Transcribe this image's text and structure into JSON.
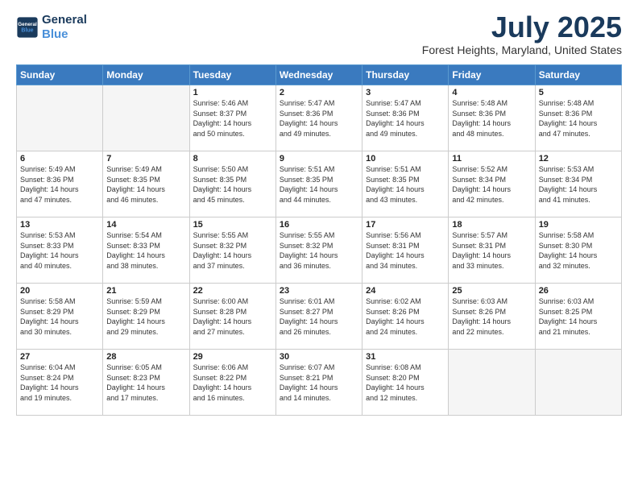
{
  "header": {
    "logo_line1": "General",
    "logo_line2": "Blue",
    "month": "July 2025",
    "location": "Forest Heights, Maryland, United States"
  },
  "days_of_week": [
    "Sunday",
    "Monday",
    "Tuesday",
    "Wednesday",
    "Thursday",
    "Friday",
    "Saturday"
  ],
  "weeks": [
    [
      {
        "day": "",
        "info": ""
      },
      {
        "day": "",
        "info": ""
      },
      {
        "day": "1",
        "info": "Sunrise: 5:46 AM\nSunset: 8:37 PM\nDaylight: 14 hours\nand 50 minutes."
      },
      {
        "day": "2",
        "info": "Sunrise: 5:47 AM\nSunset: 8:36 PM\nDaylight: 14 hours\nand 49 minutes."
      },
      {
        "day": "3",
        "info": "Sunrise: 5:47 AM\nSunset: 8:36 PM\nDaylight: 14 hours\nand 49 minutes."
      },
      {
        "day": "4",
        "info": "Sunrise: 5:48 AM\nSunset: 8:36 PM\nDaylight: 14 hours\nand 48 minutes."
      },
      {
        "day": "5",
        "info": "Sunrise: 5:48 AM\nSunset: 8:36 PM\nDaylight: 14 hours\nand 47 minutes."
      }
    ],
    [
      {
        "day": "6",
        "info": "Sunrise: 5:49 AM\nSunset: 8:36 PM\nDaylight: 14 hours\nand 47 minutes."
      },
      {
        "day": "7",
        "info": "Sunrise: 5:49 AM\nSunset: 8:35 PM\nDaylight: 14 hours\nand 46 minutes."
      },
      {
        "day": "8",
        "info": "Sunrise: 5:50 AM\nSunset: 8:35 PM\nDaylight: 14 hours\nand 45 minutes."
      },
      {
        "day": "9",
        "info": "Sunrise: 5:51 AM\nSunset: 8:35 PM\nDaylight: 14 hours\nand 44 minutes."
      },
      {
        "day": "10",
        "info": "Sunrise: 5:51 AM\nSunset: 8:35 PM\nDaylight: 14 hours\nand 43 minutes."
      },
      {
        "day": "11",
        "info": "Sunrise: 5:52 AM\nSunset: 8:34 PM\nDaylight: 14 hours\nand 42 minutes."
      },
      {
        "day": "12",
        "info": "Sunrise: 5:53 AM\nSunset: 8:34 PM\nDaylight: 14 hours\nand 41 minutes."
      }
    ],
    [
      {
        "day": "13",
        "info": "Sunrise: 5:53 AM\nSunset: 8:33 PM\nDaylight: 14 hours\nand 40 minutes."
      },
      {
        "day": "14",
        "info": "Sunrise: 5:54 AM\nSunset: 8:33 PM\nDaylight: 14 hours\nand 38 minutes."
      },
      {
        "day": "15",
        "info": "Sunrise: 5:55 AM\nSunset: 8:32 PM\nDaylight: 14 hours\nand 37 minutes."
      },
      {
        "day": "16",
        "info": "Sunrise: 5:55 AM\nSunset: 8:32 PM\nDaylight: 14 hours\nand 36 minutes."
      },
      {
        "day": "17",
        "info": "Sunrise: 5:56 AM\nSunset: 8:31 PM\nDaylight: 14 hours\nand 34 minutes."
      },
      {
        "day": "18",
        "info": "Sunrise: 5:57 AM\nSunset: 8:31 PM\nDaylight: 14 hours\nand 33 minutes."
      },
      {
        "day": "19",
        "info": "Sunrise: 5:58 AM\nSunset: 8:30 PM\nDaylight: 14 hours\nand 32 minutes."
      }
    ],
    [
      {
        "day": "20",
        "info": "Sunrise: 5:58 AM\nSunset: 8:29 PM\nDaylight: 14 hours\nand 30 minutes."
      },
      {
        "day": "21",
        "info": "Sunrise: 5:59 AM\nSunset: 8:29 PM\nDaylight: 14 hours\nand 29 minutes."
      },
      {
        "day": "22",
        "info": "Sunrise: 6:00 AM\nSunset: 8:28 PM\nDaylight: 14 hours\nand 27 minutes."
      },
      {
        "day": "23",
        "info": "Sunrise: 6:01 AM\nSunset: 8:27 PM\nDaylight: 14 hours\nand 26 minutes."
      },
      {
        "day": "24",
        "info": "Sunrise: 6:02 AM\nSunset: 8:26 PM\nDaylight: 14 hours\nand 24 minutes."
      },
      {
        "day": "25",
        "info": "Sunrise: 6:03 AM\nSunset: 8:26 PM\nDaylight: 14 hours\nand 22 minutes."
      },
      {
        "day": "26",
        "info": "Sunrise: 6:03 AM\nSunset: 8:25 PM\nDaylight: 14 hours\nand 21 minutes."
      }
    ],
    [
      {
        "day": "27",
        "info": "Sunrise: 6:04 AM\nSunset: 8:24 PM\nDaylight: 14 hours\nand 19 minutes."
      },
      {
        "day": "28",
        "info": "Sunrise: 6:05 AM\nSunset: 8:23 PM\nDaylight: 14 hours\nand 17 minutes."
      },
      {
        "day": "29",
        "info": "Sunrise: 6:06 AM\nSunset: 8:22 PM\nDaylight: 14 hours\nand 16 minutes."
      },
      {
        "day": "30",
        "info": "Sunrise: 6:07 AM\nSunset: 8:21 PM\nDaylight: 14 hours\nand 14 minutes."
      },
      {
        "day": "31",
        "info": "Sunrise: 6:08 AM\nSunset: 8:20 PM\nDaylight: 14 hours\nand 12 minutes."
      },
      {
        "day": "",
        "info": ""
      },
      {
        "day": "",
        "info": ""
      }
    ]
  ]
}
